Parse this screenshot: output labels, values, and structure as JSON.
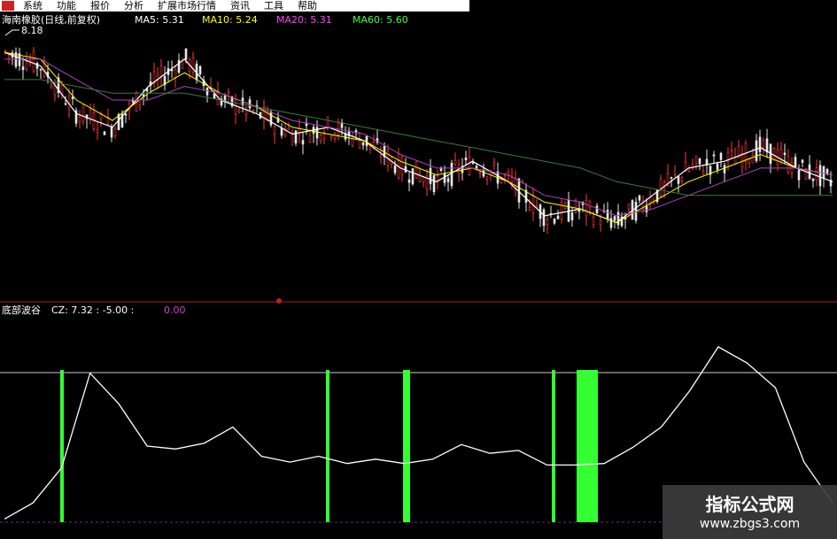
{
  "menu": {
    "items": [
      "系统",
      "功能",
      "报价",
      "分析",
      "扩展市场行情",
      "资讯",
      "工具",
      "帮助"
    ]
  },
  "price_panel": {
    "title": "海南橡胶(日线,前复权)",
    "ma5": "MA5: 5.31",
    "ma10": "MA10: 5.24",
    "ma20": "MA20: 5.31",
    "ma60": "MA60: 5.60",
    "high_label": "8.18",
    "colors": {
      "title": "#ffffff",
      "ma5": "#ffffff",
      "ma10": "#ffff00",
      "ma20": "#ff44ff",
      "ma60": "#44ff44",
      "up_candle": "#ff3b3b",
      "down_candle": "#e8e8e8",
      "ma_line_20": "#b040c0",
      "ma_line_60": "#3a7a3a"
    }
  },
  "indicator_panel": {
    "title": "底部波谷",
    "cz_label": "CZ: 7.32 : -5.00 :",
    "cz_value": "0.00",
    "colors": {
      "line": "#ffffff",
      "bars": "#33ff33",
      "value": "#cc44cc"
    }
  },
  "chart_data": [
    {
      "type": "line",
      "title": "海南橡胶(日线,前复权)",
      "series": [
        {
          "name": "MA5",
          "values": [
            8.0,
            7.8,
            7.1,
            6.9,
            7.5,
            7.9,
            7.3,
            7.1,
            6.8,
            6.9,
            6.7,
            6.3,
            6.1,
            6.4,
            6.1,
            5.6,
            5.7,
            5.5,
            5.9,
            6.3,
            6.4,
            6.6,
            6.3,
            6.1
          ]
        },
        {
          "name": "MA10",
          "values": [
            8.0,
            7.9,
            7.3,
            7.0,
            7.4,
            7.7,
            7.4,
            7.2,
            6.9,
            6.8,
            6.7,
            6.4,
            6.2,
            6.3,
            6.1,
            5.8,
            5.7,
            5.5,
            5.8,
            6.1,
            6.3,
            6.5,
            6.3,
            6.2
          ]
        },
        {
          "name": "MA20",
          "values": [
            7.9,
            7.9,
            7.6,
            7.3,
            7.3,
            7.5,
            7.4,
            7.2,
            7.0,
            6.9,
            6.8,
            6.5,
            6.3,
            6.3,
            6.2,
            5.9,
            5.8,
            5.6,
            5.7,
            5.9,
            6.1,
            6.3,
            6.3,
            6.2
          ]
        },
        {
          "name": "MA60",
          "values": [
            7.6,
            7.6,
            7.5,
            7.4,
            7.4,
            7.4,
            7.3,
            7.2,
            7.1,
            7.0,
            6.9,
            6.8,
            6.7,
            6.6,
            6.5,
            6.4,
            6.3,
            6.1,
            6.0,
            5.9,
            5.9,
            5.9,
            5.9,
            5.9
          ]
        }
      ]
    },
    {
      "type": "line",
      "title": "底部波谷",
      "series": [
        {
          "name": "CZ",
          "values": [
            -4.9,
            -3.8,
            -1.4,
            5.1,
            3.0,
            0.1,
            -0.1,
            0.3,
            1.4,
            -0.6,
            -1.0,
            -0.6,
            -1.1,
            -0.8,
            -1.1,
            -0.8,
            0.2,
            -0.4,
            -0.2,
            -1.2,
            -1.2,
            -1.1,
            0.0,
            1.4,
            3.9,
            6.9,
            5.8,
            4.1,
            -1.0,
            -3.8
          ]
        }
      ],
      "signal_bars": [
        70,
        370,
        459,
        625,
        663
      ]
    }
  ]
}
